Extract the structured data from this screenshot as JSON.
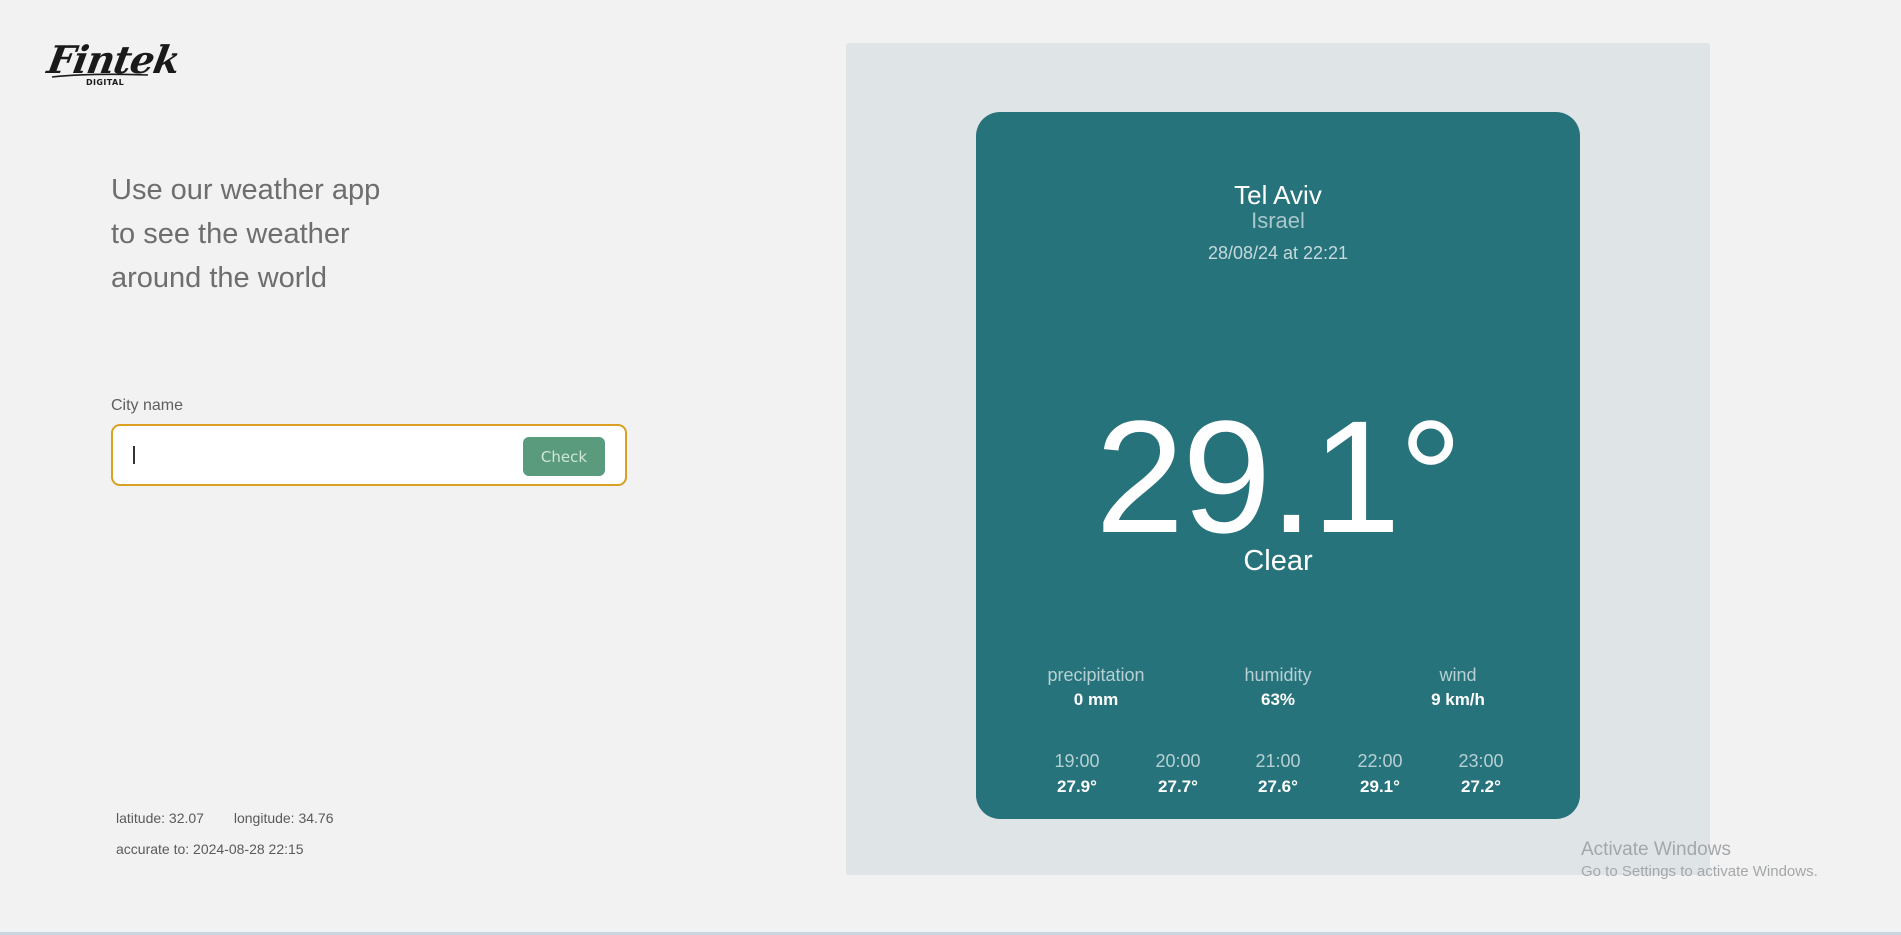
{
  "logo": {
    "text": "Fintek",
    "subtext": "DIGITAL"
  },
  "headline": "Use our weather app to see the weather around the world",
  "search": {
    "label": "City name",
    "value": "",
    "placeholder": "",
    "button_label": "Check"
  },
  "location": {
    "latitude": "latitude: 32.07",
    "longitude": "longitude: 34.76",
    "accuracy": "accurate to: 2024-08-28 22:15"
  },
  "weather": {
    "city": "Tel Aviv",
    "country": "Israel",
    "datetime": "28/08/24 at 22:21",
    "temperature": "29.1°",
    "condition": "Clear",
    "stats": [
      {
        "label": "precipitation",
        "value": "0 mm"
      },
      {
        "label": "humidity",
        "value": "63%"
      },
      {
        "label": "wind",
        "value": "9 km/h"
      }
    ],
    "hourly": [
      {
        "time": "19:00",
        "temp": "27.9°"
      },
      {
        "time": "20:00",
        "temp": "27.7°"
      },
      {
        "time": "21:00",
        "temp": "27.6°"
      },
      {
        "time": "22:00",
        "temp": "29.1°"
      },
      {
        "time": "23:00",
        "temp": "27.2°"
      }
    ]
  },
  "os_overlay": {
    "title": "Activate Windows",
    "subtitle": "Go to Settings to activate Windows."
  },
  "colors": {
    "background": "#f2f2f2",
    "panel": "#dfe5e6",
    "card": "#27737c",
    "button": "#5a9b7d",
    "input_border": "#d9a021"
  }
}
